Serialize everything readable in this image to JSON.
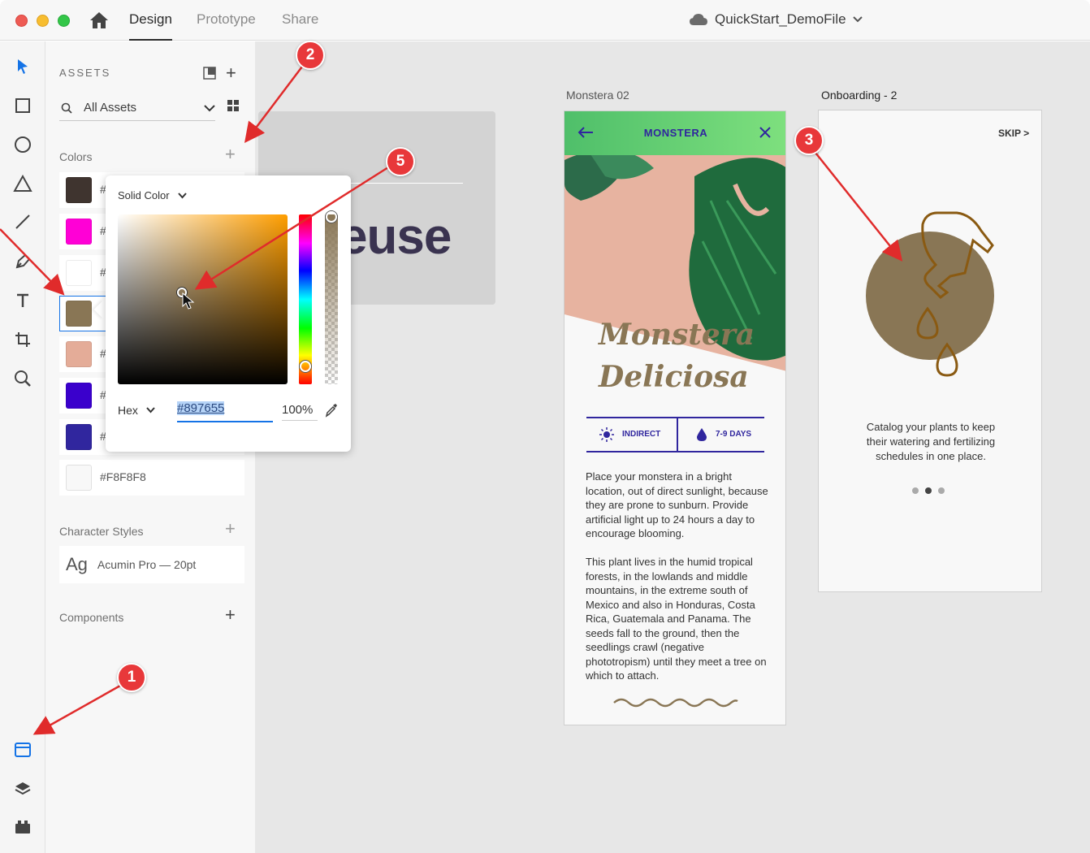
{
  "titlebar": {
    "tabs": [
      "Design",
      "Prototype",
      "Share"
    ],
    "active_tab": "Design",
    "document_title": "QuickStart_DemoFile"
  },
  "assets": {
    "header": "ASSETS",
    "search_label": "All Assets",
    "colors_label": "Colors",
    "colors": [
      {
        "hex": "#3F342F",
        "label": "#"
      },
      {
        "hex": "#FF00D6",
        "label": "#"
      },
      {
        "hex": "#FFFFFF",
        "label": "#"
      },
      {
        "hex": "#897655",
        "label": ""
      },
      {
        "hex": "#E4AC98",
        "label": "#"
      },
      {
        "hex": "#3A00CC",
        "label": "#"
      },
      {
        "hex": "#30269E",
        "label": "#"
      },
      {
        "hex": "#F8F8F8",
        "label": "#F8F8F8"
      }
    ],
    "character_styles_label": "Character Styles",
    "char_style_sample": "Ag",
    "char_style_name": "Acumin Pro — 20pt",
    "components_label": "Components"
  },
  "picker": {
    "mode": "Solid Color",
    "format": "Hex",
    "hex_value": "#897655",
    "opacity": "100%"
  },
  "canvas": {
    "behind_card_text": "euse",
    "artboard1_label": "Monstera 02",
    "artboard2_label": "Onboarding - 2"
  },
  "monstera": {
    "header_title": "MONSTERA",
    "title_line1": "Monstera",
    "title_line2": "Deliciosa",
    "light_label": "INDIRECT",
    "water_label": "7-9 DAYS",
    "paragraph1": "Place your monstera in a bright location, out of direct sunlight, because they are prone to sunburn. Provide artificial light up to 24 hours a day to encourage blooming.",
    "paragraph2": "This plant lives in the humid tropical forests, in the lowlands and middle mountains, in the extreme south of Mexico and also in Honduras, Costa Rica, Guatemala and Panama. The seeds fall to the ground, then the seedlings crawl (negative phototropism) until they meet a tree on which to attach."
  },
  "onboarding": {
    "skip_label": "SKIP >",
    "caption": "Catalog your plants to keep their watering and fertilizing schedules in one place.",
    "circle_color": "#897655"
  },
  "markers": [
    "1",
    "2",
    "3",
    "5"
  ],
  "colors": {
    "accent_blue": "#1473E6",
    "marker_red": "#E8383A",
    "brand_purple": "#30269E",
    "brown": "#897655"
  }
}
